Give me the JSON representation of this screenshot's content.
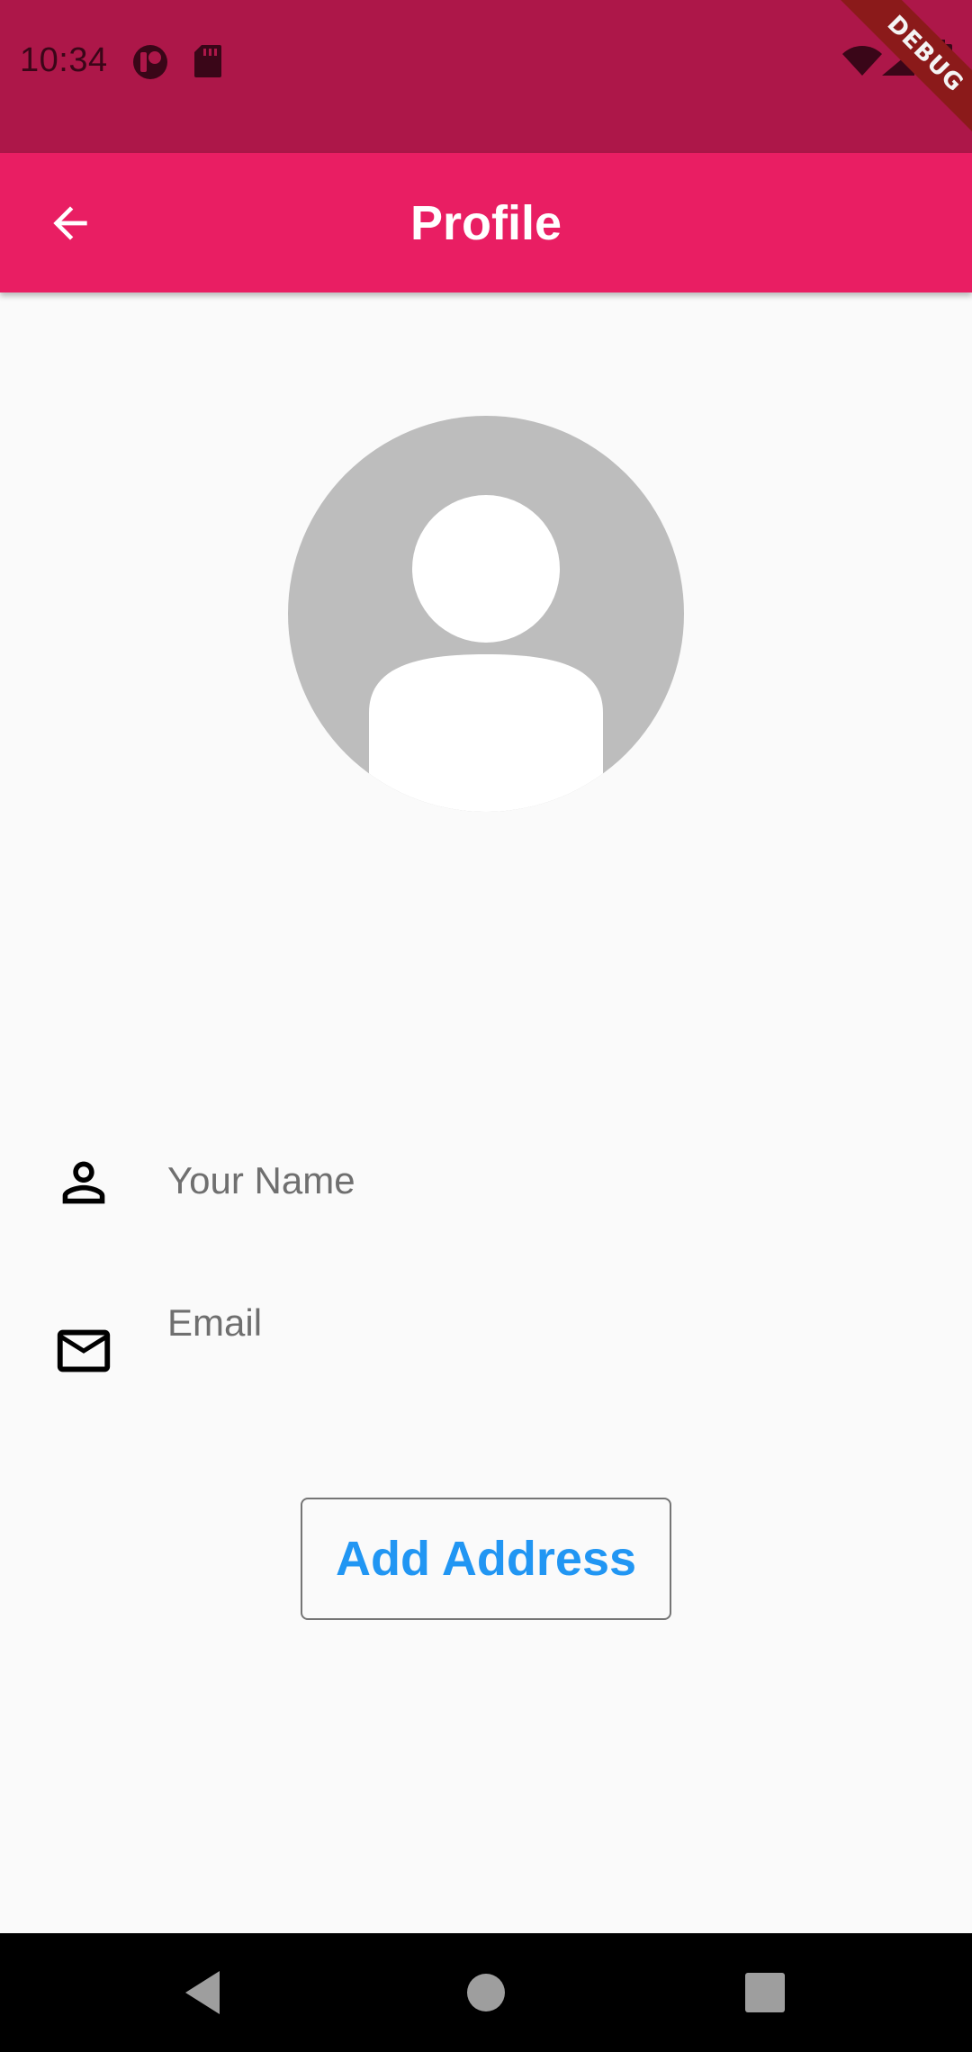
{
  "status_bar": {
    "time": "10:34",
    "icons": [
      "app-notification-icon",
      "sd-card-icon",
      "wifi-icon",
      "signal-icon",
      "battery-icon"
    ]
  },
  "debug_banner": {
    "label": "DEBUG"
  },
  "app_bar": {
    "title": "Profile",
    "back_icon": "arrow-back-icon"
  },
  "avatar": {
    "icon": "person-placeholder-icon"
  },
  "form": {
    "name": {
      "value": "",
      "placeholder": "Your Name",
      "icon": "person-outline-icon"
    },
    "email": {
      "value": "",
      "placeholder": "Email",
      "icon": "mail-outline-icon"
    }
  },
  "actions": {
    "add_address_label": "Add Address"
  },
  "nav_bar": {
    "buttons": [
      "back-icon",
      "home-icon",
      "recents-icon"
    ]
  },
  "colors": {
    "status_bar": "#ad1749",
    "app_bar": "#e91e63",
    "background": "#fafafa",
    "avatar_bg": "#bdbdbd",
    "button_text": "#2196f3",
    "debug_banner": "#8b1a1a"
  }
}
